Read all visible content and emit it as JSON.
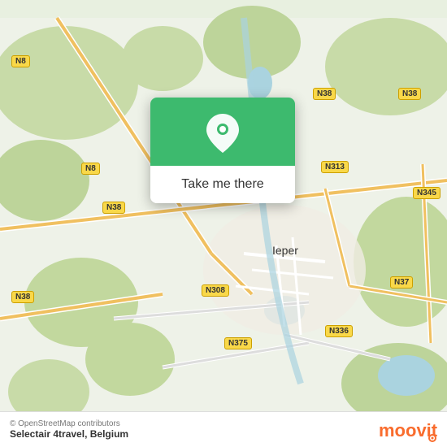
{
  "map": {
    "attribution": "© OpenStreetMap contributors",
    "city": "Ieper",
    "country": "Belgium",
    "app": "Selectair 4travel",
    "roads": {
      "n8_labels": [
        "N8",
        "N8"
      ],
      "n38_labels": [
        "N38",
        "N38",
        "N38"
      ],
      "n313_label": "N313",
      "n345_label": "N345",
      "n308_label": "N308",
      "n375_label": "N375",
      "n336_label": "N336",
      "n37_label": "N37"
    }
  },
  "card": {
    "button_label": "Take me there"
  },
  "icons": {
    "pin": "location-pin",
    "logo": "moovit-logo"
  }
}
